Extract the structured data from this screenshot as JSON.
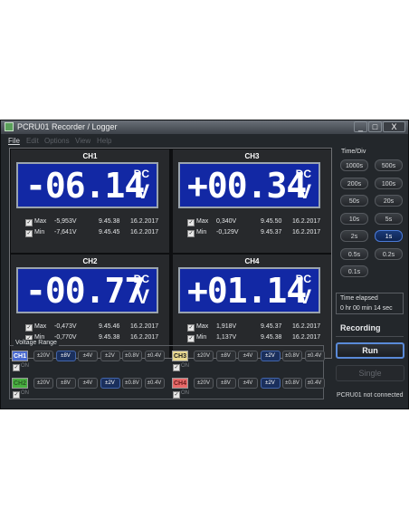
{
  "window": {
    "title": "PCRU01 Recorder / Logger",
    "buttons": [
      "_",
      "□",
      "X"
    ]
  },
  "menu": [
    {
      "label": "File",
      "enabled": true
    },
    {
      "label": "Edit",
      "enabled": false
    },
    {
      "label": "Options",
      "enabled": false
    },
    {
      "label": "View",
      "enabled": false
    },
    {
      "label": "Help",
      "enabled": false
    }
  ],
  "channels": [
    {
      "name": "CH1",
      "value": "-06.14",
      "dc": "DC",
      "unit": "V",
      "max": {
        "label": "Max",
        "value": "-5,953V",
        "time": "9.45.38",
        "date": "16.2.2017"
      },
      "min": {
        "label": "Min",
        "value": "-7,641V",
        "time": "9.45.45",
        "date": "16.2.2017"
      }
    },
    {
      "name": "CH3",
      "value": "+00.34",
      "dc": "DC",
      "unit": "V",
      "max": {
        "label": "Max",
        "value": "0,340V",
        "time": "9.45.50",
        "date": "16.2.2017"
      },
      "min": {
        "label": "Min",
        "value": "-0,129V",
        "time": "9.45.37",
        "date": "16.2.2017"
      }
    },
    {
      "name": "CH2",
      "value": "-00.77",
      "dc": "DC",
      "unit": "V",
      "max": {
        "label": "Max",
        "value": "-0,473V",
        "time": "9.45.46",
        "date": "16.2.2017"
      },
      "min": {
        "label": "Min",
        "value": "-0,770V",
        "time": "9.45.38",
        "date": "16.2.2017"
      }
    },
    {
      "name": "CH4",
      "value": "+01.14",
      "dc": "DC",
      "unit": "V",
      "max": {
        "label": "Max",
        "value": "1,918V",
        "time": "9.45.37",
        "date": "16.2.2017"
      },
      "min": {
        "label": "Min",
        "value": "1,137V",
        "time": "9.45.38",
        "date": "16.2.2017"
      }
    }
  ],
  "time_div": {
    "label": "Time/Div",
    "options": [
      "1000s",
      "500s",
      "200s",
      "100s",
      "50s",
      "20s",
      "10s",
      "5s",
      "2s",
      "1s",
      "0.5s",
      "0.2s",
      "0.1s"
    ],
    "selected": "1s"
  },
  "time_elapsed": {
    "label": "Time elapsed",
    "value": "0 hr  00 min  14 sec"
  },
  "recording_label": "Recording",
  "run_label": "Run",
  "single_label": "Single",
  "status": "PCRU01 not connected",
  "voltage_range": {
    "label": "Voltage Range",
    "on_label": "ON",
    "options": [
      "±20V",
      "±8V",
      "±4V",
      "±2V",
      "±0.8V",
      "±0.4V"
    ],
    "channels": [
      {
        "name": "CH1",
        "color": "#4a6ad0",
        "text_color": "#ffffff",
        "selected": "±8V"
      },
      {
        "name": "CH2",
        "color": "#48b040",
        "text_color": "#2a5a24",
        "selected": "±2V"
      },
      {
        "name": "CH3",
        "color": "#e8d890",
        "text_color": "#1a1a1a",
        "selected": "±2V"
      },
      {
        "name": "CH4",
        "color": "#e86a6a",
        "text_color": "#6a1a1a",
        "selected": "±2V"
      }
    ]
  },
  "colors": {
    "lcd_background": "#1228a4",
    "run_border": "#5a8ad8"
  }
}
